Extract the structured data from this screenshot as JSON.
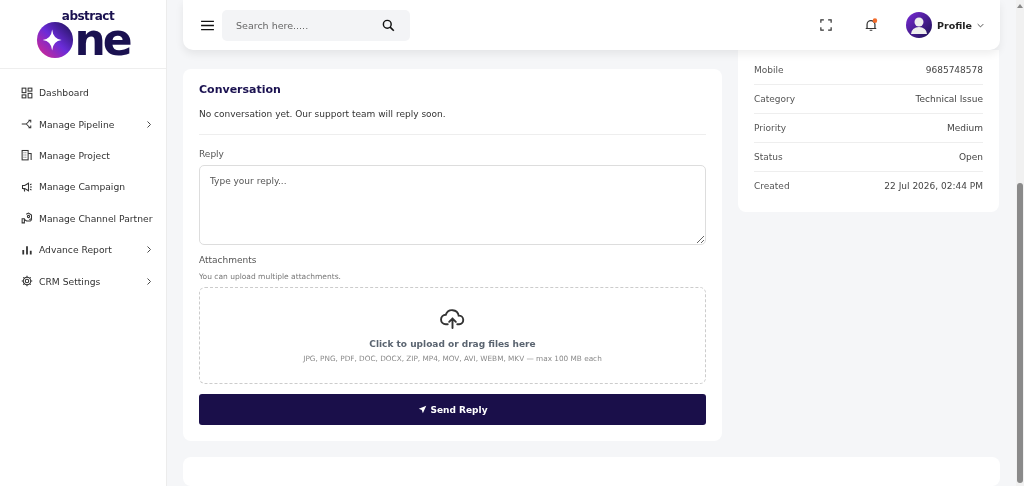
{
  "logo": {
    "top": "abstract",
    "main": "ne"
  },
  "sidebar": {
    "items": [
      {
        "label": "Dashboard",
        "expandable": false
      },
      {
        "label": "Manage Pipeline",
        "expandable": true
      },
      {
        "label": "Manage Project",
        "expandable": false
      },
      {
        "label": "Manage Campaign",
        "expandable": false
      },
      {
        "label": "Manage Channel Partner",
        "expandable": false
      },
      {
        "label": "Advance Report",
        "expandable": true
      },
      {
        "label": "CRM Settings",
        "expandable": true
      }
    ]
  },
  "header": {
    "search": {
      "placeholder": "Search here....."
    },
    "notification_dot": true,
    "profile": "Profile"
  },
  "conversation": {
    "title": "Conversation",
    "empty_message": "No conversation yet. Our support team will reply soon.",
    "reply_label": "Reply",
    "reply_placeholder": "Type your reply...",
    "attachments_label": "Attachments",
    "attachments_hint": "You can upload multiple attachments.",
    "upload_title": "Click to upload or drag files here",
    "upload_formats": "JPG, PNG, PDF, DOC, DOCX, ZIP, MP4, MOV, AVI, WEBM, MKV — max 100 MB each",
    "send_button": "Send Reply"
  },
  "details": {
    "rows": [
      {
        "label": "Mobile",
        "value": "9685748578"
      },
      {
        "label": "Category",
        "value": "Technical Issue"
      },
      {
        "label": "Priority",
        "value": "Medium"
      },
      {
        "label": "Status",
        "value": "Open"
      },
      {
        "label": "Created",
        "value": "22 Jul 2026, 02:44 PM"
      }
    ]
  }
}
